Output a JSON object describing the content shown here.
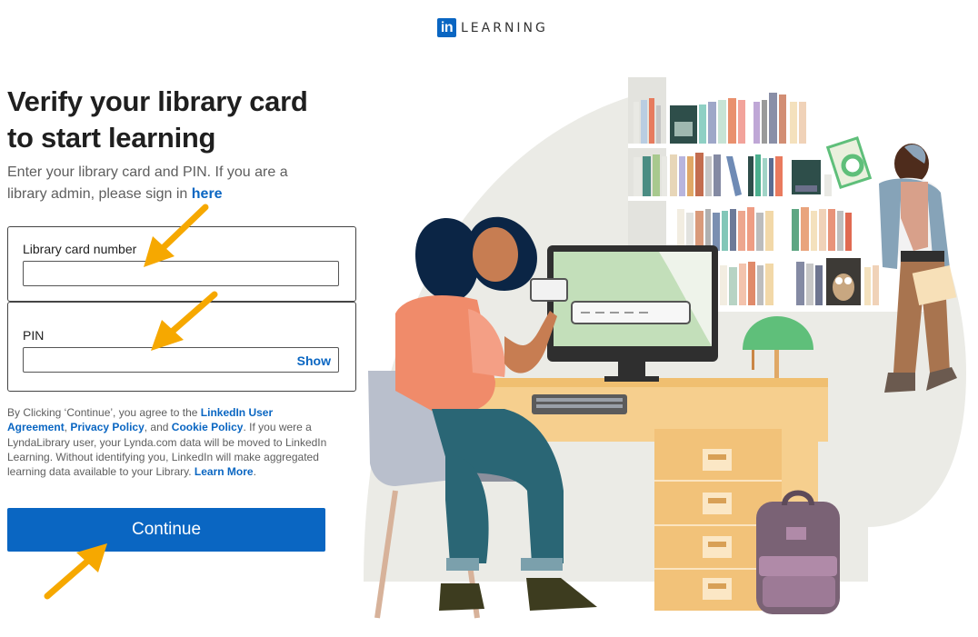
{
  "header": {
    "logo_mark": "in",
    "logo_word": "LEARNING"
  },
  "title": "Verify your library card to start learning",
  "subtitle": {
    "text": "Enter your library card and PIN. If you are a library admin, please sign in ",
    "link": "here"
  },
  "form": {
    "card_label": "Library card number",
    "card_value": "",
    "pin_label": "PIN",
    "pin_value": "",
    "show_label": "Show"
  },
  "legal": {
    "part1": "By Clicking ‘Continue’, you agree to the ",
    "link_user_agreement": "LinkedIn User Agreement",
    "part2": ", ",
    "link_privacy": "Privacy Policy",
    "part3": ", and ",
    "link_cookie": "Cookie Policy",
    "part4": ". If you were a LyndaLibrary user, your Lynda.com data will be moved to LinkedIn Learning. Without identifying you, LinkedIn will make aggregated learning data available to your Library. ",
    "link_learn_more": "Learn More",
    "part5": "."
  },
  "continue_label": "Continue",
  "colors": {
    "brand": "#0a66c2",
    "arrow": "#f6a800"
  }
}
